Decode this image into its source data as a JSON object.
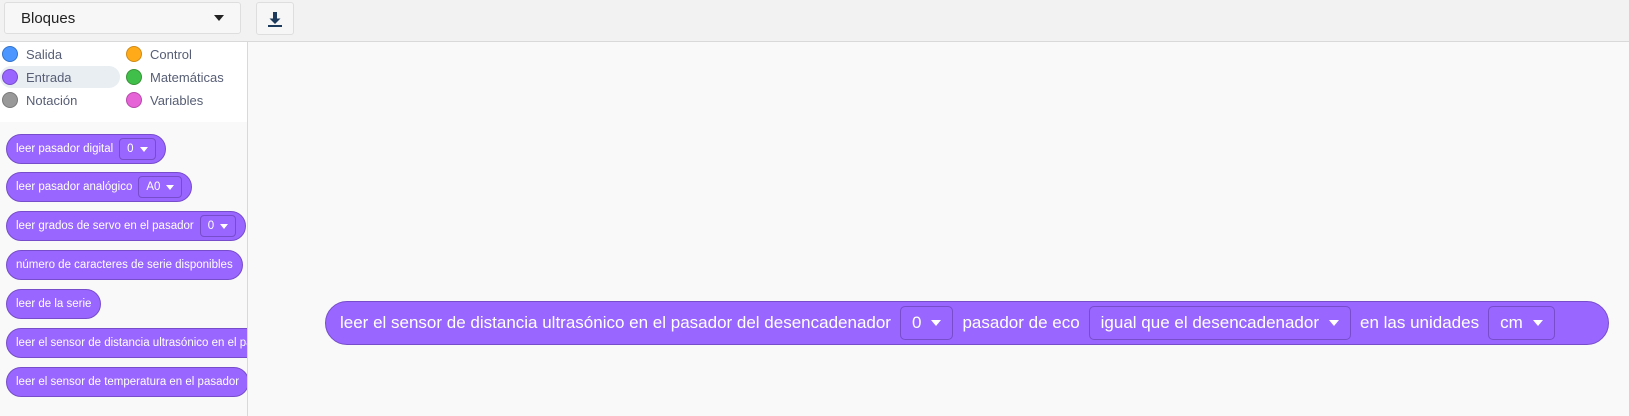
{
  "toolbar": {
    "category_select_value": "Bloques",
    "download_icon": "download-icon"
  },
  "categories": [
    {
      "label": "Salida",
      "color": "#4c97ff"
    },
    {
      "label": "Control",
      "color": "#ffab19"
    },
    {
      "label": "Entrada",
      "color": "#9966ff"
    },
    {
      "label": "Matemáticas",
      "color": "#40bf4a"
    },
    {
      "label": "Notación",
      "color": "#999999"
    },
    {
      "label": "Variables",
      "color": "#e563d7"
    }
  ],
  "selected_category": "Entrada",
  "palette": {
    "blocks": [
      {
        "text": "leer pasador digital",
        "dropdown": "0"
      },
      {
        "text": "leer pasador analógico",
        "dropdown": "A0"
      },
      {
        "text": "leer grados de servo en el pasador",
        "dropdown": "0"
      },
      {
        "text": "número de caracteres de serie disponibles"
      },
      {
        "text": "leer de la serie"
      },
      {
        "text": "leer el sensor de distancia ultrasónico en el pasador"
      },
      {
        "text": "leer el sensor de temperatura en el pasador"
      }
    ]
  },
  "workspace": {
    "main_block": {
      "part1": "leer el sensor de distancia ultrasónico en el pasador del desencadenador",
      "trigger_pin": "0",
      "part2": "pasador de eco",
      "echo_pin": "igual que el desencadenador",
      "part3": "en las unidades",
      "units": "cm"
    }
  },
  "colors": {
    "block_fill": "#9966ff",
    "block_border": "#774dcb"
  }
}
